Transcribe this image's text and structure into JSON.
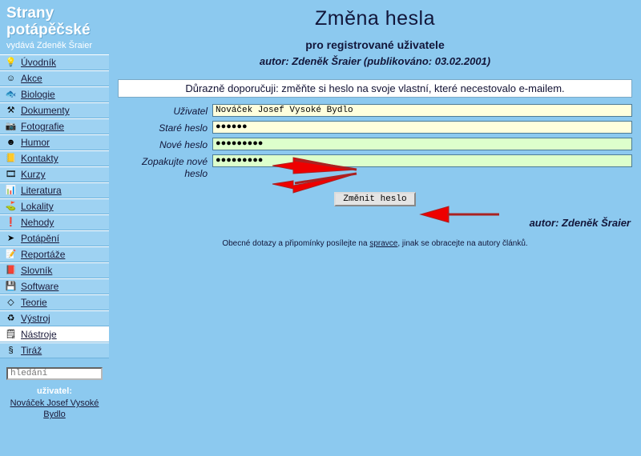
{
  "site": {
    "brand_line1": "Strany",
    "brand_line2": "potápěčské",
    "brand_subtitle": "vydává Zdeněk Šraier"
  },
  "sidebar": {
    "items": [
      {
        "label": "Úvodník",
        "icon": "lightbulb-icon",
        "glyph": "💡",
        "active": false
      },
      {
        "label": "Akce",
        "icon": "smiley-icon",
        "glyph": "☺",
        "active": false
      },
      {
        "label": "Biologie",
        "icon": "fish-icon",
        "glyph": "🐟",
        "active": false
      },
      {
        "label": "Dokumenty",
        "icon": "stamp-icon",
        "glyph": "⚒",
        "active": false
      },
      {
        "label": "Fotografie",
        "icon": "camera-icon",
        "glyph": "📷",
        "active": false
      },
      {
        "label": "Humor",
        "icon": "clown-icon",
        "glyph": "☻",
        "active": false
      },
      {
        "label": "Kontakty",
        "icon": "addressbook-icon",
        "glyph": "📒",
        "active": false
      },
      {
        "label": "Kurzy",
        "icon": "projector-icon",
        "glyph": "🎞",
        "active": false
      },
      {
        "label": "Literatura",
        "icon": "books-icon",
        "glyph": "📊",
        "active": false
      },
      {
        "label": "Lokality",
        "icon": "diveflag-icon",
        "glyph": "⛳",
        "active": false
      },
      {
        "label": "Nehody",
        "icon": "exclamation-icon",
        "glyph": "❗",
        "active": false
      },
      {
        "label": "Potápění",
        "icon": "diver-icon",
        "glyph": "➤",
        "active": false
      },
      {
        "label": "Reportáže",
        "icon": "notepad-icon",
        "glyph": "📝",
        "active": false
      },
      {
        "label": "Slovník",
        "icon": "dictionary-icon",
        "glyph": "📕",
        "active": false
      },
      {
        "label": "Software",
        "icon": "floppy-icon",
        "glyph": "💾",
        "active": false
      },
      {
        "label": "Teorie",
        "icon": "book-icon",
        "glyph": "◇",
        "active": false
      },
      {
        "label": "Výstroj",
        "icon": "tanks-icon",
        "glyph": "♻",
        "active": false
      },
      {
        "label": "Nástroje",
        "icon": "tools-icon",
        "glyph": "🗒",
        "active": true
      },
      {
        "label": "Tiráž",
        "icon": "paragraph-icon",
        "glyph": "§",
        "active": false
      }
    ],
    "search": {
      "name": "search-input",
      "value": "",
      "placeholder": "hledání"
    },
    "user": {
      "label": "uživatel:",
      "name": "Nováček Josef Vysoké Bydlo"
    }
  },
  "main": {
    "title": "Změna hesla",
    "subtitle": "pro registrované uživatele",
    "author_line": "autor: Zdeněk Šraier  (publikováno: 03.02.2001)",
    "notice": "Důrazně doporučuji: změňte si heslo na svoje vlastní, které necestovalo e-mailem.",
    "form": {
      "fields": [
        {
          "label": "Uživatel",
          "value": "Nováček Josef Vysoké Bydlo",
          "type": "text",
          "tone": "cream"
        },
        {
          "label": "Staré heslo",
          "value": "●●●●●●",
          "type": "password",
          "tone": "cream"
        },
        {
          "label": "Nové heslo",
          "value": "●●●●●●●●●",
          "type": "password",
          "tone": "green"
        },
        {
          "label": "Zopakujte nové heslo",
          "value": "●●●●●●●●●",
          "type": "password",
          "tone": "green"
        }
      ],
      "submit_label": "Změnit heslo"
    },
    "byline": "autor: Zdeněk Šraier",
    "footnote_before": "Obecné dotazy a připomínky posílejte na ",
    "footnote_link": "spravce",
    "footnote_after": ", jinak se obracejte na autory článků."
  },
  "colors": {
    "page_background": "#8cc9ef",
    "nav_background": "#9ed2f2",
    "nav_active_background": "#ffffff",
    "field_cream": "#ffffdd",
    "field_green": "#ddffcc",
    "annotation_arrow": "#ee0000",
    "annotation_line": "#aa2222",
    "text_dark": "#12163a"
  },
  "annotations": {
    "arrows": [
      {
        "name": "arrow-new-password",
        "label": ""
      },
      {
        "name": "arrow-repeat-password",
        "label": ""
      },
      {
        "name": "arrow-submit-button",
        "label": ""
      }
    ]
  }
}
